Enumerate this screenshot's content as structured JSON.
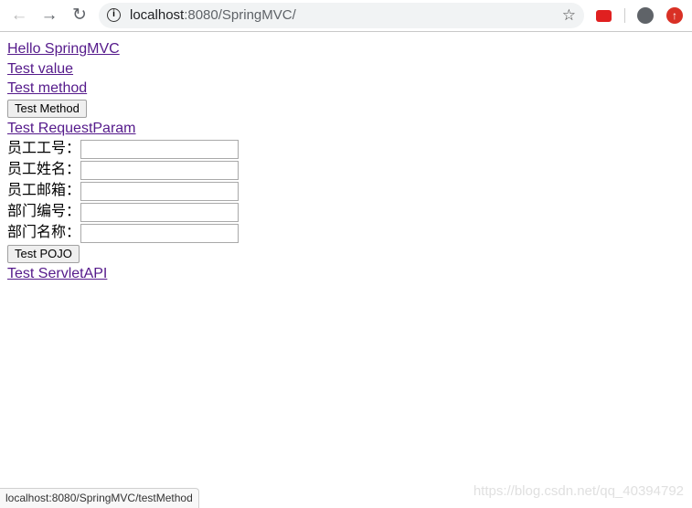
{
  "browser": {
    "url_host": "localhost",
    "url_rest": ":8080/SpringMVC/",
    "icons": {
      "back": "arrow-left-icon",
      "forward": "arrow-right-icon",
      "reload": "reload-icon",
      "info": "info-icon",
      "star": "star-icon",
      "extension1": "youtube-icon",
      "profile": "account-icon",
      "update": "update-icon"
    }
  },
  "links": {
    "hello": "Hello SpringMVC",
    "test_value": "Test value",
    "test_method": "Test method",
    "request_param": "Test RequestParam",
    "servlet_api": "Test ServletAPI"
  },
  "buttons": {
    "test_method": "Test Method",
    "test_pojo": "Test POJO"
  },
  "form": {
    "fields": [
      {
        "label": "员工工号：",
        "value": ""
      },
      {
        "label": "员工姓名：",
        "value": ""
      },
      {
        "label": "员工邮箱：",
        "value": ""
      },
      {
        "label": "部门编号：",
        "value": ""
      },
      {
        "label": "部门名称：",
        "value": ""
      }
    ]
  },
  "status_bar": "localhost:8080/SpringMVC/testMethod",
  "watermark": "https://blog.csdn.net/qq_40394792"
}
